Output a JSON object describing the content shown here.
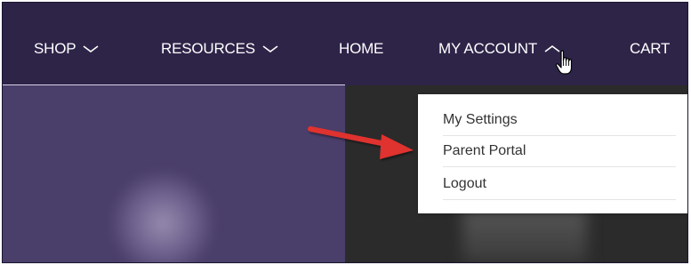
{
  "nav": {
    "items": [
      {
        "label": "SHOP",
        "has_chevron": "down"
      },
      {
        "label": "RESOURCES",
        "has_chevron": "down"
      },
      {
        "label": "HOME"
      },
      {
        "label": "MY ACCOUNT",
        "has_chevron": "up"
      },
      {
        "label": "CART"
      }
    ]
  },
  "account_menu": {
    "items": [
      {
        "label": "My Settings"
      },
      {
        "label": "Parent Portal"
      },
      {
        "label": "Logout"
      }
    ]
  },
  "icons": {
    "chevron_down": "chevron-down-icon",
    "chevron_up": "chevron-up-icon",
    "cursor": "hand-pointer-icon",
    "annotation": "red-arrow"
  },
  "colors": {
    "navbar_bg": "#2e2448",
    "hero_left_bg": "#4a3e6a",
    "hero_right_bg": "#2b2b2b",
    "dropdown_bg": "#ffffff",
    "annotation_arrow": "#e0322f"
  }
}
